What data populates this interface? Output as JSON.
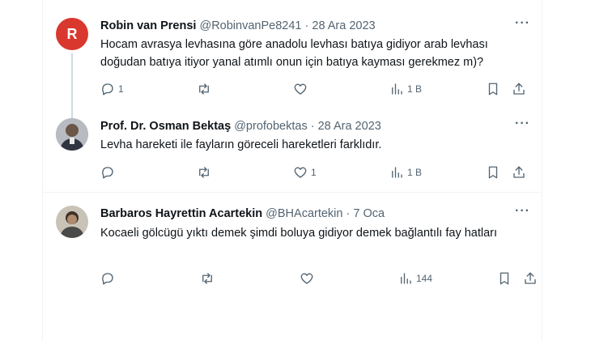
{
  "tweets": [
    {
      "avatar_letter": "R",
      "name": "Robin van Prensi",
      "handle": "@RobinvanPe8241",
      "separator": "·",
      "date": "28 Ara 2023",
      "more": "···",
      "text": "Hocam avrasya levhasına göre anadolu levhası batıya gidiyor arab levhası doğudan batıya itiyor yanal atımlı onun için batıya kayması gerekmez m)?",
      "replies": "1",
      "retweets": "",
      "likes": "",
      "views": "1 В"
    },
    {
      "avatar_letter": "",
      "name": "Prof. Dr. Osman Bektaş",
      "handle": "@profobektas",
      "separator": "·",
      "date": "28 Ara 2023",
      "more": "···",
      "text": "Levha hareketi ile fayların göreceli hareketleri farklıdır.",
      "replies": "",
      "retweets": "",
      "likes": "1",
      "views": "1 В"
    },
    {
      "avatar_letter": "",
      "name": "Barbaros Hayrettin Acartekin",
      "handle": "@BHAcartekin",
      "separator": "·",
      "date": "7 Oca",
      "more": "···",
      "text": "Kocaeli gölcügü yıktı demek şimdi boluya gidiyor demek bağlantılı fay hatları",
      "replies": "",
      "retweets": "",
      "likes": "",
      "views": "144"
    }
  ],
  "icons": {
    "reply": "reply-icon",
    "retweet": "retweet-icon",
    "like": "heart-icon",
    "views": "views-icon",
    "bookmark": "bookmark-icon",
    "share": "share-icon"
  },
  "colors": {
    "avatar_r": "#d9382f",
    "text": "#0f1419",
    "muted": "#536471",
    "divider": "#eff3f4",
    "thread": "#cfd9de"
  }
}
